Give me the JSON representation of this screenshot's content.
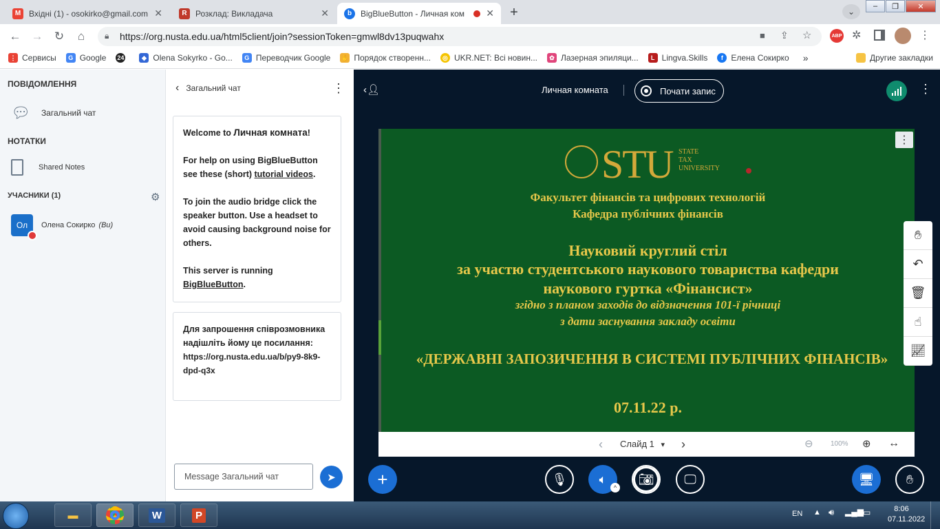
{
  "browser": {
    "tabs": [
      {
        "title": "Вхідні (1) - osokirko@gmail.com",
        "icon": "gmail-icon",
        "color": "#ea4335"
      },
      {
        "title": "Розклад: Викладача",
        "icon": "schedule-icon",
        "color": "#c0392b"
      },
      {
        "title": "BigBlueButton - Личная ком",
        "icon": "bigbluebutton-icon",
        "color": "#1a73e8"
      }
    ],
    "url": "https://org.nusta.edu.ua/html5client/join?sessionToken=gmwl8dv13puqwahx",
    "bookmarks": [
      {
        "label": "Сервисы",
        "icon": "apps-icon",
        "color": "#e94235"
      },
      {
        "label": "Google",
        "icon": "google-icon",
        "color": "#4285f4"
      },
      {
        "label": "",
        "icon": "badge-24-icon",
        "color": "#222222",
        "text": "24"
      },
      {
        "label": "Olena Sokyrko - Go...",
        "icon": "diamond-icon",
        "color": "#3367d6"
      },
      {
        "label": "Переводчик Google",
        "icon": "translate-icon",
        "color": "#4285f4"
      },
      {
        "label": "Порядок створенн...",
        "icon": "hand-icon",
        "color": "#f2b134"
      },
      {
        "label": "UKR.NET: Всі новин...",
        "icon": "ukrnet-icon",
        "color": "#f5c400"
      },
      {
        "label": "Лазерная эпиляци...",
        "icon": "butterfly-icon",
        "color": "#e0457b"
      },
      {
        "label": "Lingva.Skills",
        "icon": "lingva-icon",
        "color": "#b71c1c",
        "text": "L"
      },
      {
        "label": "Елена Сокирко",
        "icon": "facebook-icon",
        "color": "#1877f2",
        "text": "f"
      }
    ],
    "bookmarks_more": "»",
    "other_bookmarks": "Другие закладки"
  },
  "sidebar": {
    "messages_title": "ПОВІДОМЛЕННЯ",
    "public_chat": "Загальний чат",
    "notes_title": "НОТАТКИ",
    "shared_notes": "Shared Notes",
    "users_title": "УЧАСНИКИ (1)",
    "user": {
      "avatar": "Ол",
      "name": "Олена Сокирко",
      "you": "(Ви)"
    }
  },
  "chat": {
    "title": "Загальний чат",
    "welcome": {
      "line1_a": "Welcome to ",
      "room": "Личная комната",
      "line1_b": "!",
      "help_a": "For help on using BigBlueButton see these (short) ",
      "help_link": "tutorial videos",
      "help_b": ".",
      "audio": "To join the audio bridge click the speaker button. Use a headset to avoid causing background noise for others.",
      "server_a": "This server is running ",
      "server_link": "BigBlueButton",
      "server_b": "."
    },
    "invite": "Для запрошення співрозмовника надішліть йому це посилання:",
    "invite_link": "https://org.nusta.edu.ua/b/py9-8k9-dpd-q3x",
    "input_placeholder": "Message Загальний чат"
  },
  "meeting": {
    "room_name": "Личная комната",
    "record": "Почати запис"
  },
  "slide": {
    "logo": "STU",
    "logo_small": [
      "STATE",
      "TAX",
      "UNIVERSITY"
    ],
    "faculty": "Факультет фінансів та цифрових технологій",
    "department": "Кафедра публічних фінансів",
    "title1": "Науковий круглий стіл",
    "title2": "за участю студентського наукового товариства кафедри",
    "title3": "наукового гуртка «Фінансист»",
    "sub1": "згідно з планом заходів до відзначення 101-ї річниці",
    "sub2": "з дати заснування закладу освіти",
    "theme": "«ДЕРЖАВНІ ЗАПОЗИЧЕННЯ В СИСТЕМІ ПУБЛІЧНИХ ФІНАНСІВ»",
    "date": "07.11.22 р."
  },
  "slidebar": {
    "slide": "Слайд 1",
    "zoom": "100%"
  },
  "taskbar": {
    "lang": "EN",
    "time": "8:06",
    "date": "07.11.2022"
  }
}
